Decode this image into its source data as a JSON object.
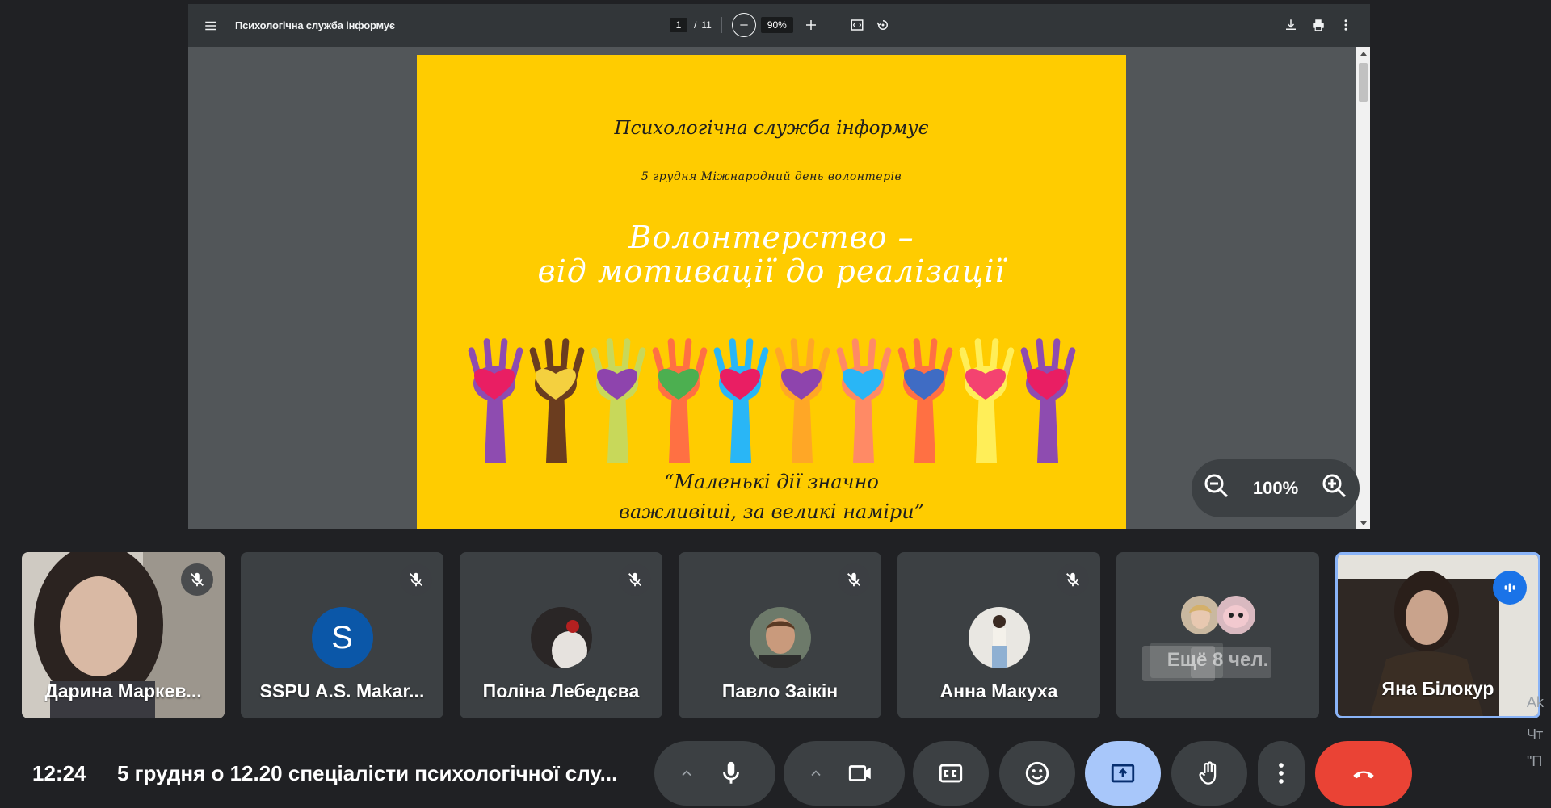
{
  "pdf_viewer": {
    "doc_title": "Психологічна служба інформує",
    "page_current": "1",
    "page_separator": "/",
    "page_total": "11",
    "zoom_value": "90%"
  },
  "slide": {
    "title": "Психологічна служба інформує",
    "date_line": "5 грудня Міжнародний день волонтерів",
    "heading_line1": "Волонтерство –",
    "heading_line2": "від мотивації до реалізації",
    "quote_line1": "“Маленькі дії значно",
    "quote_line2": "важливіші, за великі наміри”"
  },
  "zoom_overlay": {
    "value": "100%"
  },
  "participants": [
    {
      "name": "Дарина Маркев...",
      "muted": true,
      "type": "video"
    },
    {
      "name": "SSPU A.S. Makar...",
      "muted": true,
      "type": "letter",
      "letter": "S",
      "color": "#0b57a8"
    },
    {
      "name": "Поліна Лебедєва",
      "muted": true,
      "type": "photo"
    },
    {
      "name": "Павло Заікін",
      "muted": true,
      "type": "photo"
    },
    {
      "name": "Анна Макуха",
      "muted": true,
      "type": "photo"
    },
    {
      "name": "",
      "type": "more",
      "more_text": "Ещё 8 чел."
    },
    {
      "name": "Яна Білокур",
      "muted": false,
      "type": "video",
      "speaking": true
    }
  ],
  "bottom_bar": {
    "time": "12:24",
    "meeting_title": "5 грудня о 12.20 спеціалісти психологічної слу..."
  },
  "side_fragments": [
    "Ak",
    "Чт",
    "\"П"
  ],
  "colors": {
    "accent": "#8ab4f8",
    "end_call": "#ea4335",
    "present": "#a8c7fa",
    "slide_bg": "#ffcc00"
  }
}
